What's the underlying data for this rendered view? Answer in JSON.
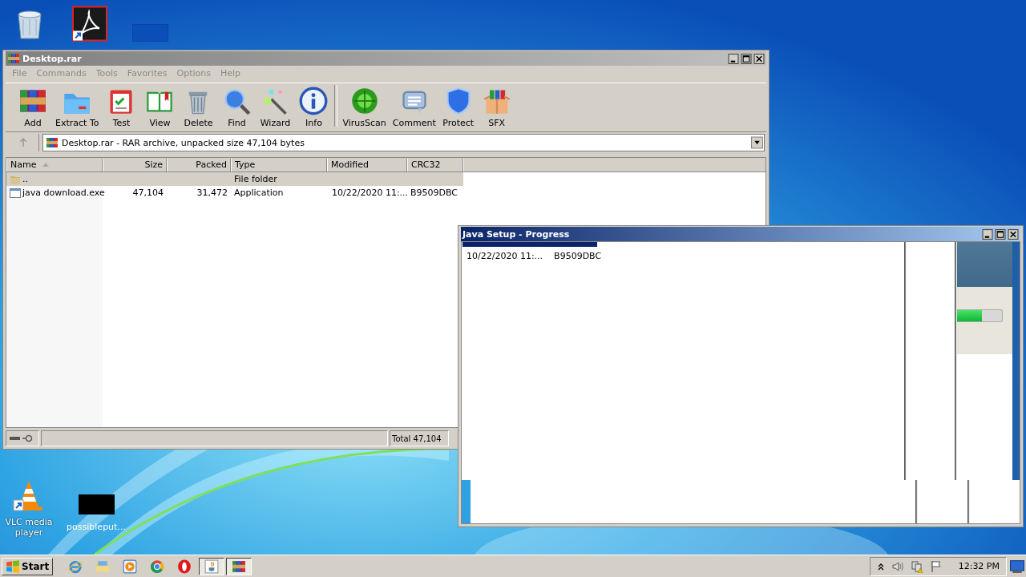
{
  "desktop": {
    "icons": [
      {
        "kind": "recycle-bin"
      },
      {
        "kind": "pdf-shortcut"
      },
      {
        "kind": "blank"
      },
      {
        "kind": "vlc",
        "label": "VLC media player"
      },
      {
        "kind": "black-file",
        "label": "possibleput..."
      }
    ]
  },
  "archive_window": {
    "title": "Desktop.rar",
    "menu": [
      "File",
      "Commands",
      "Tools",
      "Favorites",
      "Options",
      "Help"
    ],
    "toolbar": [
      {
        "kind": "add",
        "label": "Add"
      },
      {
        "kind": "extract",
        "label": "Extract To"
      },
      {
        "kind": "test",
        "label": "Test"
      },
      {
        "kind": "view",
        "label": "View"
      },
      {
        "kind": "delete",
        "label": "Delete"
      },
      {
        "kind": "find",
        "label": "Find"
      },
      {
        "kind": "wizard",
        "label": "Wizard"
      },
      {
        "kind": "info",
        "label": "Info"
      },
      {
        "kind": "separator"
      },
      {
        "kind": "virus",
        "label": "VirusScan"
      },
      {
        "kind": "comment",
        "label": "Comment"
      },
      {
        "kind": "protect",
        "label": "Protect"
      },
      {
        "kind": "sfx",
        "label": "SFX"
      }
    ],
    "address": "Desktop.rar - RAR archive, unpacked size 47,104 bytes",
    "table": {
      "columns": [
        "Name",
        "Size",
        "Packed",
        "Type",
        "Modified",
        "CRC32"
      ],
      "rows": [
        {
          "kind": "folder",
          "selected": true,
          "cells": [
            "..",
            "",
            "",
            "File folder",
            "",
            ""
          ]
        },
        {
          "kind": "exe",
          "selected": false,
          "cells": [
            "java download.exe",
            "47,104",
            "31,472",
            "Application",
            "10/22/2020 11:...",
            "B9509DBC"
          ]
        }
      ]
    },
    "status_bar": {
      "total": "Total 47,104"
    }
  },
  "setup_window": {
    "title": "Java Setup - Progress",
    "row": [
      "10/22/2020 11:...",
      "B9509DBC"
    ],
    "progress": {
      "level": 0.55
    }
  },
  "taskbar": {
    "start": "Start",
    "apps": [
      {
        "kind": "ie",
        "selected": false
      },
      {
        "kind": "explorer",
        "selected": false
      },
      {
        "kind": "media",
        "selected": false
      },
      {
        "kind": "chrome",
        "selected": false
      },
      {
        "kind": "opera",
        "selected": false
      },
      {
        "kind": "java",
        "selected": true
      },
      {
        "kind": "winrar",
        "selected": true
      }
    ],
    "tray": {
      "time": "12:32 PM"
    }
  }
}
